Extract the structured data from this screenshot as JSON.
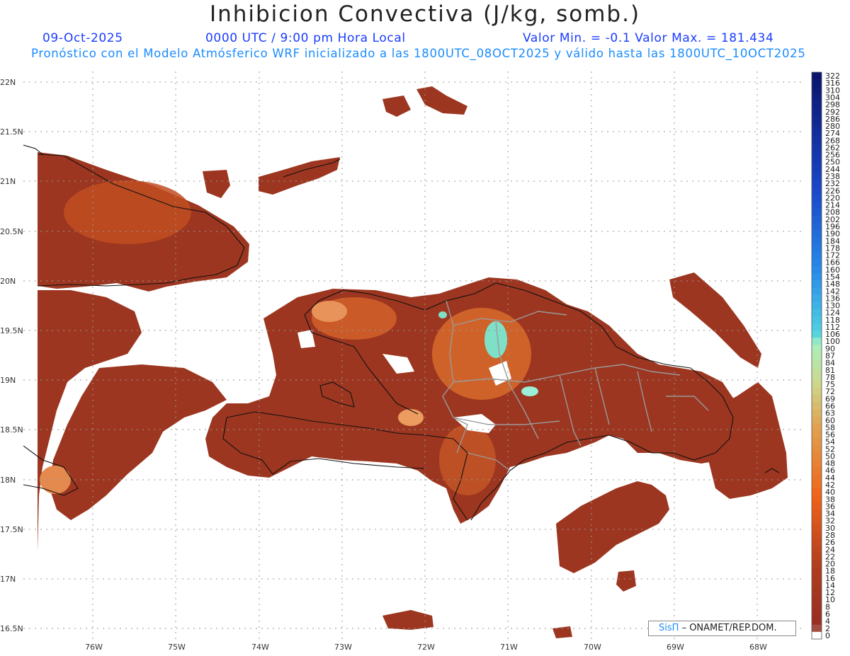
{
  "header": {
    "title": "Inhibicion Convectiva (J/kg, somb.)",
    "date": "09-Oct-2025",
    "time": "0000 UTC / 9:00 pm Hora Local",
    "minmax": "Valor Min. = -0.1  Valor Max. = 181.434",
    "subtitle": "Pronóstico con el Modelo Atmósferico WRF inicializado a las 1800UTC_08OCT2025 y válido hasta las  1800UTC_10OCT2025"
  },
  "map": {
    "lat_labels": [
      "22N",
      "21.5N",
      "21N",
      "20.5N",
      "20N",
      "19.5N",
      "19N",
      "18.5N",
      "18N",
      "17.5N",
      "17N",
      "16.5N"
    ],
    "lon_labels": [
      "76W",
      "75W",
      "74W",
      "73W",
      "72W",
      "71W",
      "70W",
      "69W",
      "68W"
    ],
    "field_colors": {
      "low": "#9c3620",
      "mid": "#e0701a",
      "high": "#f4a060",
      "peak": "#7fe0c8"
    }
  },
  "colorbar": {
    "labels": [
      "322",
      "316",
      "310",
      "304",
      "298",
      "292",
      "286",
      "280",
      "274",
      "268",
      "262",
      "256",
      "250",
      "244",
      "238",
      "232",
      "226",
      "220",
      "214",
      "208",
      "202",
      "196",
      "190",
      "184",
      "178",
      "172",
      "166",
      "160",
      "154",
      "148",
      "142",
      "136",
      "130",
      "124",
      "118",
      "112",
      "106",
      "100",
      "90",
      "87",
      "84",
      "81",
      "78",
      "75",
      "72",
      "69",
      "66",
      "63",
      "60",
      "58",
      "56",
      "54",
      "52",
      "50",
      "48",
      "46",
      "44",
      "42",
      "40",
      "38",
      "36",
      "34",
      "32",
      "30",
      "28",
      "26",
      "24",
      "22",
      "20",
      "18",
      "16",
      "14",
      "12",
      "10",
      "8",
      "6",
      "4",
      "2",
      "0"
    ]
  },
  "credit": {
    "sis": "SisΠ",
    "org": "– ONAMET/REP.DOM."
  }
}
